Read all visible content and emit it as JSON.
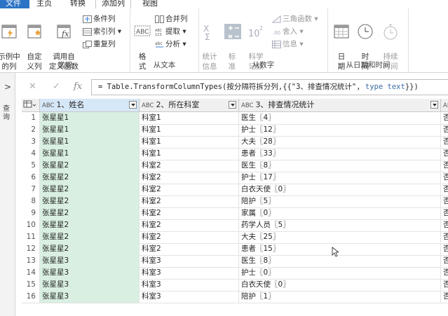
{
  "tabs": [
    {
      "label": "文件"
    },
    {
      "label": "主页"
    },
    {
      "label": "转换"
    },
    {
      "label": "添加列"
    },
    {
      "label": "视图"
    }
  ],
  "ribbon": {
    "groups": {
      "general": {
        "label": "常规",
        "example_col": "示例中\n的列",
        "custom_col": "自定\n义列",
        "invoke_fn": "调用自\n定义函数",
        "conditional_col": "条件列",
        "index_col": "索引列",
        "duplicate_col": "重复列"
      },
      "text": {
        "label": "从文本",
        "format": "格\n式",
        "merge_cols": "合并列",
        "extract": "提取",
        "parse": "分析",
        "abc_label": "ABC"
      },
      "number": {
        "label": "从数字",
        "statistics": "统计\n信息",
        "standard": "标\n准",
        "scientific": "科学\n记数",
        "trig": "三角函数",
        "rounding": "舍入",
        "info": "信息"
      },
      "datetime": {
        "label": "从日期和时间",
        "date": "日\n期",
        "time": "时\n间",
        "duration": "持续\n时间"
      }
    }
  },
  "leftpane": {
    "label": "查询"
  },
  "formula": {
    "prefix": "= Table.TransformColumnTypes(按分隔符拆分列,{{\"3、排查情况统计\", ",
    "kw": "type",
    "type": " text",
    "suffix": "}})"
  },
  "grid": {
    "columns": [
      {
        "type": "ABC",
        "name": "1、姓名"
      },
      {
        "type": "ABC",
        "name": "2、所在科室"
      },
      {
        "type": "ABC",
        "name": "3、排查情况统计"
      },
      {
        "type": "AB",
        "name": ""
      }
    ],
    "rows": [
      {
        "n": "1",
        "name": "张星星1",
        "dept": "科室1",
        "stat": "医生〖4〗",
        "last": "否"
      },
      {
        "n": "2",
        "name": "张星星1",
        "dept": "科室1",
        "stat": "护士〖12〗",
        "last": "否"
      },
      {
        "n": "3",
        "name": "张星星1",
        "dept": "科室1",
        "stat": "大夫〖28〗",
        "last": "否"
      },
      {
        "n": "4",
        "name": "张星星1",
        "dept": "科室1",
        "stat": "患者〖33〗",
        "last": "否"
      },
      {
        "n": "5",
        "name": "张星星2",
        "dept": "科室2",
        "stat": "医生〖8〗",
        "last": "否"
      },
      {
        "n": "6",
        "name": "张星星2",
        "dept": "科室2",
        "stat": "护士〖17〗",
        "last": "否"
      },
      {
        "n": "7",
        "name": "张星星2",
        "dept": "科室2",
        "stat": "白衣天使〖0〗",
        "last": "否"
      },
      {
        "n": "8",
        "name": "张星星2",
        "dept": "科室2",
        "stat": "陪护〖5〗",
        "last": "否"
      },
      {
        "n": "9",
        "name": "张星星2",
        "dept": "科室2",
        "stat": "家属〖0〗",
        "last": "否"
      },
      {
        "n": "10",
        "name": "张星星2",
        "dept": "科室2",
        "stat": "药学人员〖5〗",
        "last": "否"
      },
      {
        "n": "11",
        "name": "张星星2",
        "dept": "科室2",
        "stat": "大夫〖25〗",
        "last": "否"
      },
      {
        "n": "12",
        "name": "张星星2",
        "dept": "科室2",
        "stat": "患者〖15〗",
        "last": "否"
      },
      {
        "n": "13",
        "name": "张星星3",
        "dept": "科室3",
        "stat": "医生〖8〗",
        "last": "否"
      },
      {
        "n": "14",
        "name": "张星星3",
        "dept": "科室3",
        "stat": "护士〖0〗",
        "last": "否"
      },
      {
        "n": "15",
        "name": "张星星3",
        "dept": "科室3",
        "stat": "白衣天使〖0〗",
        "last": "否"
      },
      {
        "n": "16",
        "name": "张星星3",
        "dept": "科室3",
        "stat": "陪护〖1〗",
        "last": "否"
      }
    ]
  },
  "colors": {
    "accent": "#2b73c4",
    "name_col": "#d9efe1",
    "header_sel": "#d6e7f7"
  }
}
